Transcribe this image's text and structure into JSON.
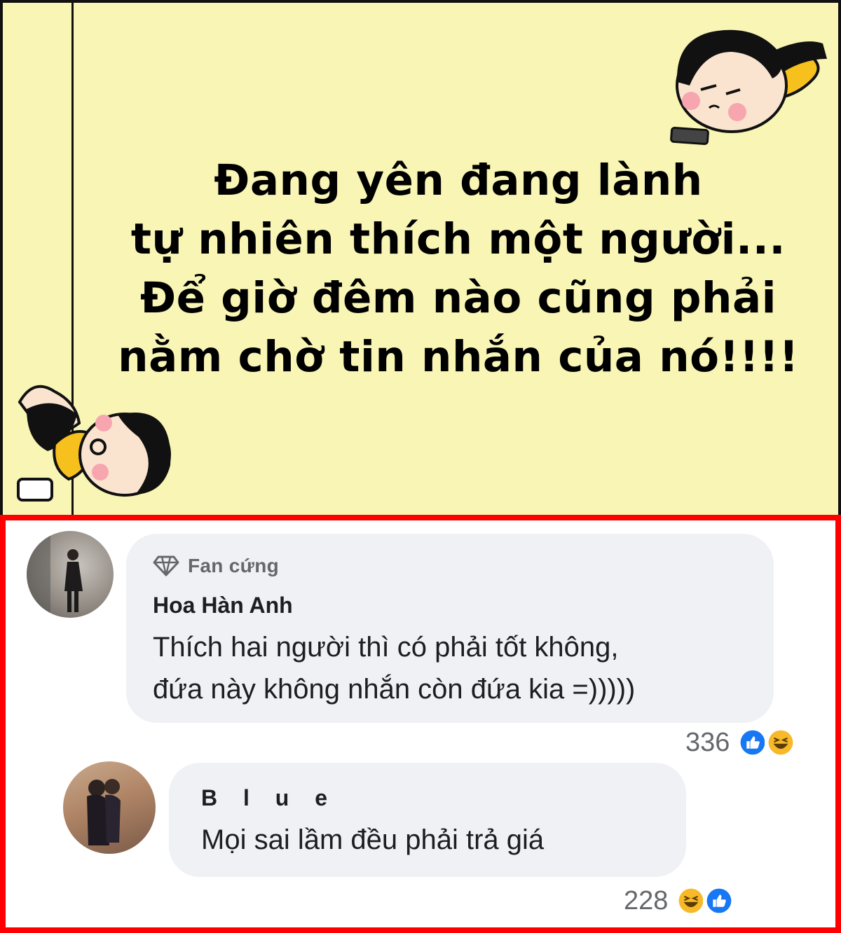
{
  "meme": {
    "caption_lines": [
      "Đang yên đang lành",
      "tự nhiên thích một người...",
      "Để giờ đêm nào cũng phải",
      "nằm chờ tin nhắn của nó!!!!"
    ]
  },
  "comments": [
    {
      "badge": "Fan cứng",
      "badge_icon": "diamond-icon",
      "author": "Hoa Hàn Anh",
      "text_lines": [
        "Thích hai người thì có phải tốt không,",
        "đứa này không nhắn còn đứa kia =)))))"
      ],
      "reaction_count": "336",
      "reactions": [
        "like-icon",
        "haha-icon"
      ]
    },
    {
      "author": "B l u e",
      "text": "Mọi sai lầm đều phải trả giá",
      "reaction_count": "228",
      "reactions": [
        "haha-icon",
        "like-icon"
      ]
    }
  ],
  "colors": {
    "panel_background": "#f8f5b5",
    "frame_border": "#ff0000",
    "bubble_background": "#eff1f4",
    "like_blue": "#1877f2",
    "haha_yellow": "#f7b928"
  }
}
